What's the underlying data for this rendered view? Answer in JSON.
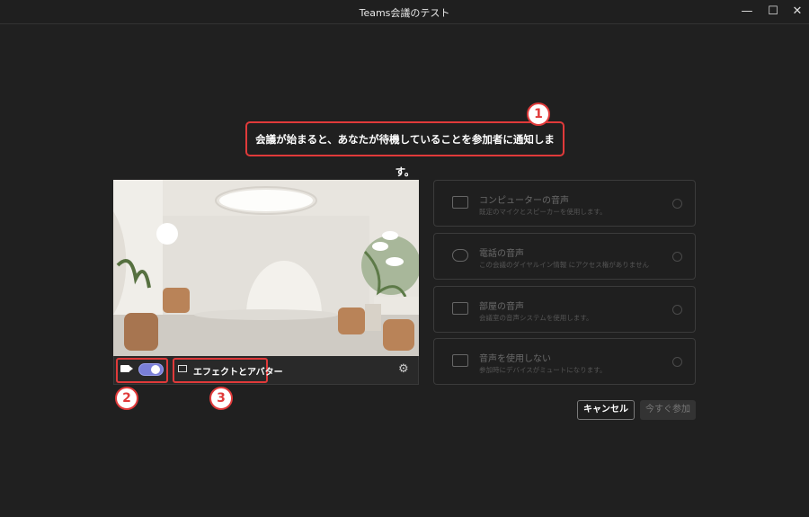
{
  "window": {
    "title": "Teams会議のテスト",
    "controls": [
      "—",
      "☐",
      "✕"
    ]
  },
  "notice": {
    "text": "会議が始まると、あなたが待機していることを参加者に通知します。"
  },
  "markers": [
    "1",
    "2",
    "3"
  ],
  "video": {
    "camera_on": true,
    "effects_label": "エフェクトとアバター"
  },
  "audio_options": [
    {
      "title": "コンピューターの音声",
      "desc": "既定のマイクとスピーカーを使用します。",
      "icon": "computer-icon"
    },
    {
      "title": "電話の音声",
      "desc": "この会議のダイヤルイン情報 にアクセス権がありません",
      "icon": "phone-icon"
    },
    {
      "title": "部屋の音声",
      "desc": "会議室の音声システムを使用します。",
      "icon": "room-icon"
    },
    {
      "title": "音声を使用しない",
      "desc": "参加時にデバイスがミュートになります。",
      "icon": "speaker-off-icon"
    }
  ],
  "buttons": {
    "cancel": "キャンセル",
    "join": "今すぐ参加"
  },
  "colors": {
    "highlight": "#e03a3a",
    "toggle": "#7a7fd8"
  }
}
